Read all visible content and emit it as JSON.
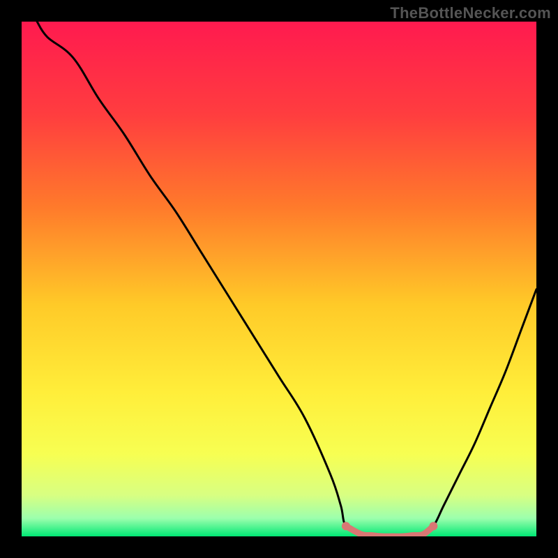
{
  "watermark": "TheBottleNecker.com",
  "colors": {
    "frame": "#000000",
    "curve": "#000000",
    "marker_fill": "#d97774",
    "marker_stroke": "#d97774",
    "watermark": "#555555"
  },
  "chart_data": {
    "type": "line",
    "title": "",
    "xlabel": "",
    "ylabel": "",
    "xlim": [
      0,
      100
    ],
    "ylim": [
      0,
      100
    ],
    "axes_visible": false,
    "background": "rainbow-vertical-gradient",
    "gradient_stops": [
      {
        "offset": 0,
        "color": "#ff1a4f"
      },
      {
        "offset": 18,
        "color": "#ff3d3f"
      },
      {
        "offset": 36,
        "color": "#ff7a2b"
      },
      {
        "offset": 55,
        "color": "#ffca28"
      },
      {
        "offset": 72,
        "color": "#ffee3a"
      },
      {
        "offset": 84,
        "color": "#f7ff52"
      },
      {
        "offset": 92,
        "color": "#d8ff82"
      },
      {
        "offset": 96.5,
        "color": "#9cffad"
      },
      {
        "offset": 100,
        "color": "#00e874"
      }
    ],
    "description": "V-shaped bottleneck curve: bottleneck percentage (implied y) falls from ~100 at x≈3 to ~0 across x≈63–80 plateau, then rises toward ~48 at x=100.",
    "series": [
      {
        "name": "bottleneck-curve",
        "color": "#000000",
        "x": [
          3,
          5,
          10,
          15,
          20,
          25,
          30,
          35,
          40,
          45,
          50,
          55,
          60,
          62,
          63,
          66,
          70,
          74,
          78,
          80,
          82,
          85,
          88,
          91,
          94,
          97,
          100
        ],
        "y": [
          100,
          97,
          93,
          85,
          78,
          70,
          63,
          55,
          47,
          39,
          31,
          23,
          12,
          6,
          2,
          0.4,
          0,
          0,
          0.4,
          2,
          6,
          12,
          18,
          25,
          32,
          40,
          48
        ]
      }
    ],
    "plateau_markers": {
      "name": "optimal-range",
      "color": "#d97774",
      "x": [
        63,
        66,
        68,
        70,
        72,
        74,
        76,
        78,
        80
      ],
      "y": [
        2,
        0.4,
        0.2,
        0,
        0,
        0,
        0.2,
        0.4,
        2
      ]
    }
  }
}
